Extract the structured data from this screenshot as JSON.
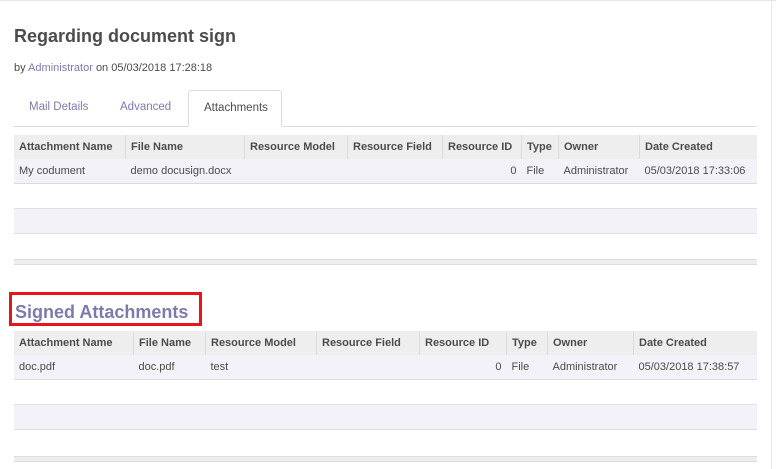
{
  "record": {
    "title": "Regarding document sign",
    "by_prefix": "by",
    "author": "Administrator",
    "on_text": "on 05/03/2018 17:28:18"
  },
  "tabs": [
    {
      "label": "Mail Details"
    },
    {
      "label": "Advanced"
    },
    {
      "label": "Attachments"
    }
  ],
  "attachments": {
    "headers": [
      "Attachment Name",
      "File Name",
      "Resource Model",
      "Resource Field",
      "Resource ID",
      "Type",
      "Owner",
      "Date Created"
    ],
    "rows": [
      [
        "My codument",
        "demo docusign.docx",
        "",
        "",
        "0",
        "File",
        "Administrator",
        "05/03/2018 17:33:06"
      ]
    ]
  },
  "signed_attachments": {
    "title": "Signed Attachments",
    "headers": [
      "Attachment Name",
      "File Name",
      "Resource Model",
      "Resource Field",
      "Resource ID",
      "Type",
      "Owner",
      "Date Created"
    ],
    "rows": [
      [
        "doc.pdf",
        "doc.pdf",
        "test",
        "",
        "0",
        "File",
        "Administrator",
        "05/03/2018 17:38:57"
      ]
    ]
  },
  "colors": {
    "link": "#7c7bad",
    "highlight_box": "#e8141d"
  }
}
